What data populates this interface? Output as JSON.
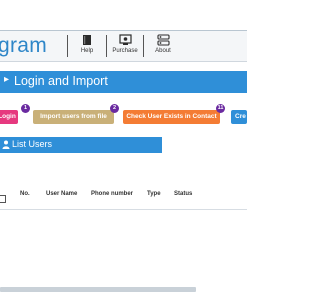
{
  "brand": {
    "text": "gram"
  },
  "ribbon": {
    "items": [
      {
        "label": "Help",
        "icon": "book-icon"
      },
      {
        "label": "Purchase",
        "icon": "purchase-icon"
      },
      {
        "label": "About",
        "icon": "about-icon"
      }
    ]
  },
  "section": {
    "title": "Login and Import"
  },
  "actions": [
    {
      "label": "Login",
      "badge": "",
      "color": "#e6397f"
    },
    {
      "label": "Import users from file",
      "badge": "1",
      "color": "#c9b078"
    },
    {
      "label": "Check User Exists in Contact",
      "badge": "2",
      "color": "#f47c34"
    },
    {
      "label": "Cre",
      "badge": "11",
      "color": "#2f8fd8"
    }
  ],
  "list_panel": {
    "title": "List Users",
    "icon": "user-icon"
  },
  "table": {
    "columns": [
      "No.",
      "User Name",
      "Phone number",
      "Type",
      "Status"
    ]
  }
}
